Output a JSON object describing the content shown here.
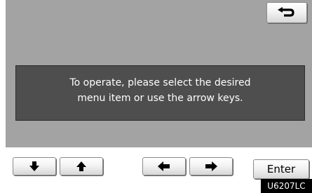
{
  "message": {
    "line1": "To operate, please select the desired",
    "line2": "menu item or use the arrow keys."
  },
  "buttons": {
    "back_icon": "return-arrow-icon",
    "down_icon": "arrow-down-icon",
    "up_icon": "arrow-up-icon",
    "left_icon": "arrow-left-icon",
    "right_icon": "arrow-right-icon",
    "enter_label": "Enter"
  },
  "figure_code": "U6207LC",
  "colors": {
    "panel_gray": "#a3a3a3",
    "message_bg": "#4e4e4e",
    "button_face": "#f3f3f3",
    "code_bg": "#000000"
  }
}
